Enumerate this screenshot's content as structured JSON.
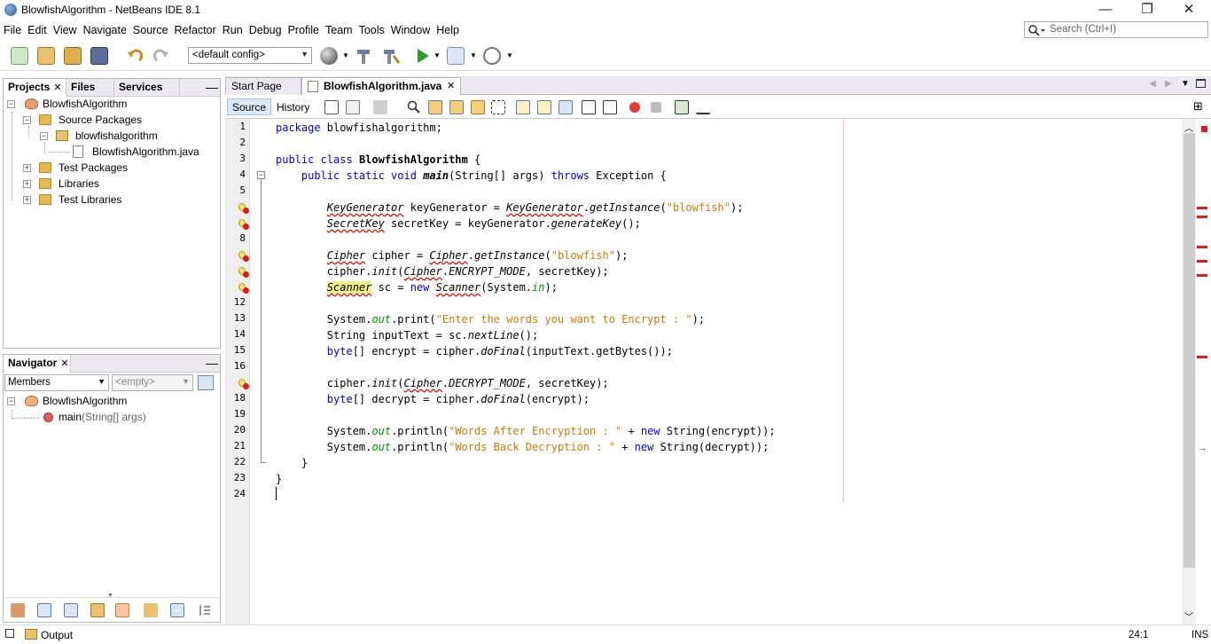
{
  "window": {
    "title": "BlowfishAlgorithm - NetBeans IDE 8.1",
    "minimize": "—",
    "maximize": "❐",
    "close": "✕"
  },
  "menubar": {
    "items": [
      "File",
      "Edit",
      "View",
      "Navigate",
      "Source",
      "Refactor",
      "Run",
      "Debug",
      "Profile",
      "Team",
      "Tools",
      "Window",
      "Help"
    ]
  },
  "search": {
    "placeholder": "Search (Ctrl+I)"
  },
  "toolbar": {
    "config": "<default config>"
  },
  "projects_pane": {
    "tabs": [
      "Projects",
      "Files",
      "Services"
    ],
    "tree": [
      {
        "label": "BlowfishAlgorithm",
        "icon": "project-icon"
      },
      {
        "label": "Source Packages",
        "icon": "folder-icon"
      },
      {
        "label": "blowfishalgorithm",
        "icon": "package-icon"
      },
      {
        "label": "BlowfishAlgorithm.java",
        "icon": "java-file-icon"
      },
      {
        "label": "Test Packages",
        "icon": "folder-icon"
      },
      {
        "label": "Libraries",
        "icon": "folder-icon"
      },
      {
        "label": "Test Libraries",
        "icon": "folder-icon"
      }
    ]
  },
  "navigator_pane": {
    "title": "Navigator",
    "members_select": "Members",
    "empty_select": "<empty>",
    "tree": [
      {
        "label": "BlowfishAlgorithm"
      },
      {
        "method": "main",
        "params": "(String[] args)"
      }
    ]
  },
  "editor": {
    "tabs": [
      "Start Page",
      "BlowfishAlgorithm.java"
    ],
    "source_label": "Source",
    "history_label": "History",
    "line_numbers": [
      "1",
      "2",
      "3",
      "4",
      "5",
      "6",
      "7",
      "8",
      "9",
      "10",
      "11",
      "12",
      "13",
      "14",
      "15",
      "16",
      "17",
      "18",
      "19",
      "20",
      "21",
      "22",
      "23",
      "24"
    ],
    "error_lines": [
      6,
      7,
      9,
      10,
      11,
      17
    ]
  },
  "statusbar": {
    "output_label": "Output",
    "position": "24:1",
    "mode": "INS"
  },
  "colors": {
    "keyword": "#0000e6",
    "string": "#ce7b00",
    "static_field": "#009900",
    "error": "#e11b1b"
  }
}
